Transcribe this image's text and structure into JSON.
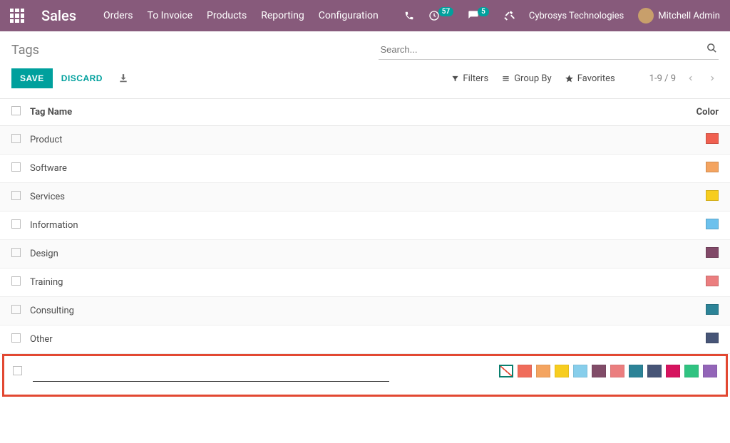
{
  "header": {
    "app_title": "Sales",
    "nav": [
      "Orders",
      "To Invoice",
      "Products",
      "Reporting",
      "Configuration"
    ],
    "activity_badge": "57",
    "discuss_badge": "5",
    "company": "Cybrosys Technologies",
    "user": "Mitchell Admin"
  },
  "breadcrumb": "Tags",
  "search": {
    "placeholder": "Search..."
  },
  "buttons": {
    "save": "SAVE",
    "discard": "DISCARD"
  },
  "controls": {
    "filters": "Filters",
    "group_by": "Group By",
    "favorites": "Favorites",
    "pager": "1-9 / 9"
  },
  "table": {
    "head_name": "Tag Name",
    "head_color": "Color",
    "rows": [
      {
        "name": "Product",
        "color": "#f06050"
      },
      {
        "name": "Software",
        "color": "#f4a460"
      },
      {
        "name": "Services",
        "color": "#f7cd1f"
      },
      {
        "name": "Information",
        "color": "#6cc1ed"
      },
      {
        "name": "Design",
        "color": "#814968"
      },
      {
        "name": "Training",
        "color": "#eb7e7f"
      },
      {
        "name": "Consulting",
        "color": "#2c8397"
      },
      {
        "name": "Other",
        "color": "#475577"
      }
    ]
  },
  "palette": [
    "none",
    "#f06c5b",
    "#f4a460",
    "#f7cd1f",
    "#87ceeb",
    "#814c68",
    "#eb7e7f",
    "#2c8397",
    "#475577",
    "#d6145f",
    "#30c381",
    "#9365b8"
  ]
}
